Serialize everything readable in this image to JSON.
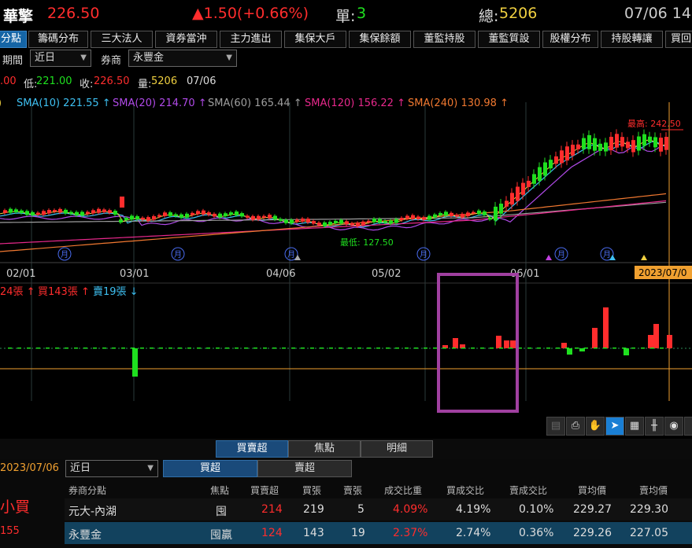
{
  "header": {
    "stock_name": "華擎",
    "price": "226.50",
    "change": "▲1.50(+0.66%)",
    "single_label": "單:",
    "single_value": "3",
    "total_label": "總:",
    "total_value": "5206",
    "date": "07/06 14"
  },
  "tabs": [
    "分點",
    "籌碼分布",
    "三大法人",
    "資券當沖",
    "主力進出",
    "集保大戶",
    "集保餘額",
    "董監持股",
    "董監質設",
    "股權分布",
    "持股轉讓",
    "買回"
  ],
  "filters": {
    "period_label": "期間",
    "period_value": "近日",
    "broker_label": "券商",
    "broker_value": "永豐金"
  },
  "quote": {
    "open_tail": ".00",
    "low_label": "低:",
    "low_value": "221.00",
    "close_label": "收:",
    "close_value": "226.50",
    "volume_label": "量:",
    "volume_value": "5206",
    "date": "07/06"
  },
  "ma": [
    {
      "label": "SMA(10) 221.55 ↑",
      "color": "#3ec0f2"
    },
    {
      "label": "SMA(20) 214.70 ↑",
      "color": "#b04ae8"
    },
    {
      "label": "SMA(60) 165.44 ↑",
      "color": "#9e9e9e"
    },
    {
      "label": "SMA(120) 156.22 ↑",
      "color": "#e8288c"
    },
    {
      "label": "SMA(240) 130.98 ↑",
      "color": "#f07830"
    }
  ],
  "price_chart": {
    "high_label": "最高: 242.50",
    "low_label": "最低: 127.50",
    "month_marker": "月",
    "x_labels": [
      "02/01",
      "03/01",
      "04/06",
      "05/02",
      "06/01"
    ],
    "cursor_date": "2023/07/0"
  },
  "volume_legend": {
    "net_tail": "24張 ↑",
    "buy": "買143張 ↑",
    "sell": "賣19張 ↓"
  },
  "toolbar_icons": [
    "document-icon",
    "print-icon",
    "hand-icon",
    "cursor-icon",
    "table-icon",
    "bar-chart-icon",
    "eye-icon",
    "more-icon"
  ],
  "subtabs": [
    "買賣超",
    "焦點",
    "明細"
  ],
  "bottom": {
    "date": "2023/07/06",
    "range_value": "近日",
    "toggle": [
      "買超",
      "賣超"
    ],
    "side_label": "小買",
    "side_value": "155",
    "columns": [
      "券商分點",
      "焦點",
      "買賣超",
      "買張",
      "賣張",
      "成交比重",
      "買成交比",
      "賣成交比",
      "買均價",
      "賣均價"
    ],
    "rows": [
      {
        "broker": "元大-內湖",
        "focus": "囤",
        "net": "214",
        "buy": "219",
        "sell": "5",
        "weight": "4.09%",
        "buy_ratio": "4.19%",
        "sell_ratio": "0.10%",
        "buy_avg": "229.27",
        "sell_avg": "229.30"
      },
      {
        "broker": "永豐金",
        "focus": "囤贏",
        "net": "124",
        "buy": "143",
        "sell": "19",
        "weight": "2.37%",
        "buy_ratio": "2.74%",
        "sell_ratio": "0.36%",
        "buy_avg": "229.26",
        "sell_avg": "227.05"
      }
    ]
  },
  "colors": {
    "up": "#ff2d2d",
    "down": "#1fe01f",
    "accent_blue": "#1565a6",
    "highlight_box": "#a040a0",
    "cursor_line": "#f0a030"
  }
}
